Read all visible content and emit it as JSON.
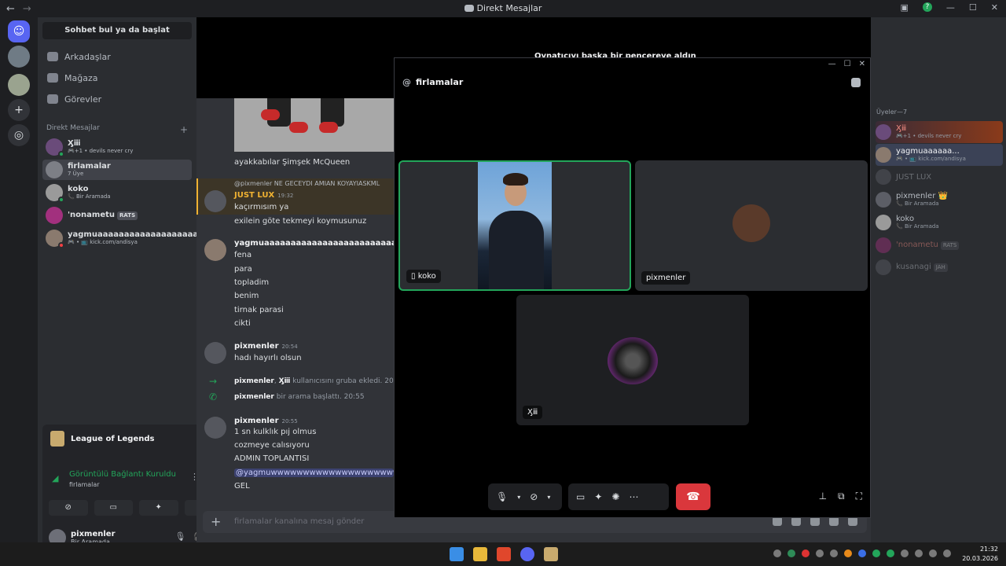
{
  "titlebar": {
    "title": "Direkt Mesajlar"
  },
  "sidebar": {
    "search_label": "Sohbet bul ya da başlat",
    "nav": [
      {
        "label": "Arkadaşlar"
      },
      {
        "label": "Mağaza"
      },
      {
        "label": "Görevler"
      }
    ],
    "dm_header": "Direkt Mesajlar",
    "dm_add": "+",
    "dms": [
      {
        "name": "Ӽⅲ",
        "sub": "🎮+1 • devils never cry"
      },
      {
        "name": "firlamalar",
        "sub": "7 Üye"
      },
      {
        "name": "koko",
        "sub": "📞 Bir Aramada"
      },
      {
        "name": "'nonametu",
        "badge": "RATS",
        "sub": ""
      },
      {
        "name": "yagmuaaaaaaaaaaaaaaaaaaaa...",
        "sub": "🎮 • 📺 kick.com/andisya"
      }
    ]
  },
  "activity": {
    "game": "League of Legends",
    "voice_status": "Görüntülü Bağlantı Kuruldu",
    "voice_channel": "firlamalar",
    "user": {
      "name": "pixmenler",
      "status": "Bir Aramada"
    }
  },
  "chat": {
    "overlay_text": "Oynatıcıyı başka bir pencereye aldın",
    "image_caption": "ayakkabılar Şimşek McQueen",
    "reply_preview": "@pixmenler NE GECEYDI AMIAN KOYAYIASKML",
    "messages": [
      {
        "author": "JUST LUX",
        "time": "19:32",
        "lines": [
          "kaçırmısım ya",
          "exilein göte tekmeyi koymusunuz"
        ]
      },
      {
        "author": "yagmuaaaaaaaaaaaaaaaaaaaaaaaaaaaaaa",
        "time": "",
        "lines": [
          "fena",
          "para",
          "topladim",
          "benim",
          "tirnak parasi",
          "cikti"
        ]
      },
      {
        "author": "pixmenler",
        "time": "20:54",
        "lines": [
          "hadı hayırlı olsun"
        ]
      },
      {
        "author": "pixmenler",
        "time": "20:55",
        "lines": [
          "1 sn kulklık pıj olmus",
          "cozmeye calısıyoru",
          "ADMIN TOPLANTISI",
          "@yagmuwwwwwwwwwwwwwwwwwwwwwwww",
          "GEL"
        ]
      }
    ],
    "sys_add": {
      "actor": "pixmenler",
      "target": "Ӽⅲ",
      "text": "kullanıcısını gruba ekledi.",
      "time": "20:5"
    },
    "sys_call": {
      "actor": "pixmenler",
      "text": "bir arama başlattı.",
      "time": "20:55"
    },
    "composer_placeholder": "firlamalar kanalına mesaj gönder"
  },
  "members": {
    "header": "Üyeler—7",
    "list": [
      {
        "name": "Ӽⅲ",
        "sub": "🎮+1 • devils never cry"
      },
      {
        "name": "yagmuaaaaaa...",
        "sub": "🎮 • 📺 kick.com/andisya"
      },
      {
        "name": "JUST LUX",
        "sub": ""
      },
      {
        "name": "pixmenler 👑",
        "sub": "📞 Bir Aramada"
      },
      {
        "name": "koko",
        "sub": "📞 Bir Aramada"
      },
      {
        "name": "'nonametu",
        "sub": "",
        "badge": "RATS"
      },
      {
        "name": "kusanagi",
        "sub": "",
        "badge": "JAH"
      }
    ]
  },
  "call": {
    "channel": "firlamalar",
    "tiles": [
      {
        "label": "koko"
      },
      {
        "label": "pixmenler"
      },
      {
        "label": "Ӽⅲ"
      }
    ]
  },
  "taskbar": {
    "time": "21:32",
    "date": "20.03.2026"
  },
  "colors": {
    "accent": "#5865f2",
    "online": "#23a55a",
    "danger": "#da373c"
  }
}
